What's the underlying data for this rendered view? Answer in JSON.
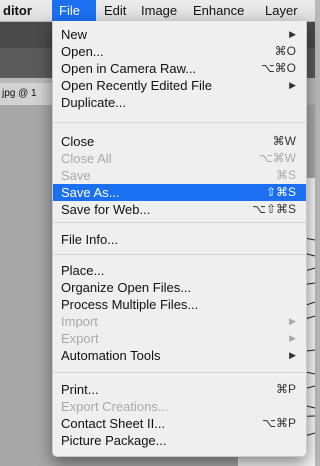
{
  "menubar": {
    "items": [
      {
        "label": "ditor"
      },
      {
        "label": "File"
      },
      {
        "label": "Edit"
      },
      {
        "label": "Image"
      },
      {
        "label": "Enhance"
      },
      {
        "label": "Layer"
      }
    ]
  },
  "document_tab": {
    "label": "jpg @ 1"
  },
  "file_menu": {
    "items": [
      {
        "label": "New",
        "shortcut": "",
        "submenu": true
      },
      {
        "label": "Open...",
        "shortcut": "⌘O"
      },
      {
        "label": "Open in Camera Raw...",
        "shortcut": "⌥⌘O"
      },
      {
        "label": "Open Recently Edited File",
        "shortcut": "",
        "submenu": true
      },
      {
        "label": "Duplicate...",
        "shortcut": ""
      },
      {
        "label": "Close",
        "shortcut": "⌘W"
      },
      {
        "label": "Close All",
        "shortcut": "⌥⌘W",
        "disabled": true
      },
      {
        "label": "Save",
        "shortcut": "⌘S",
        "disabled": true
      },
      {
        "label": "Save As...",
        "shortcut": "⇧⌘S",
        "selected": true
      },
      {
        "label": "Save for Web...",
        "shortcut": "⌥⇧⌘S"
      },
      {
        "label": "File Info...",
        "shortcut": ""
      },
      {
        "label": "Place...",
        "shortcut": ""
      },
      {
        "label": "Organize Open Files...",
        "shortcut": ""
      },
      {
        "label": "Process Multiple Files...",
        "shortcut": ""
      },
      {
        "label": "Import",
        "shortcut": "",
        "submenu": true,
        "disabled": true
      },
      {
        "label": "Export",
        "shortcut": "",
        "submenu": true,
        "disabled": true
      },
      {
        "label": "Automation Tools",
        "shortcut": "",
        "submenu": true
      },
      {
        "label": "Print...",
        "shortcut": "⌘P"
      },
      {
        "label": "Export Creations...",
        "shortcut": "",
        "disabled": true
      },
      {
        "label": "Contact Sheet II...",
        "shortcut": "⌥⌘P"
      },
      {
        "label": "Picture Package...",
        "shortcut": ""
      }
    ],
    "submenu_arrow": "▶"
  },
  "colors": {
    "highlight": "#1b6ff1",
    "menu_bg": "#efefef",
    "disabled_text": "#a9a9a9"
  }
}
